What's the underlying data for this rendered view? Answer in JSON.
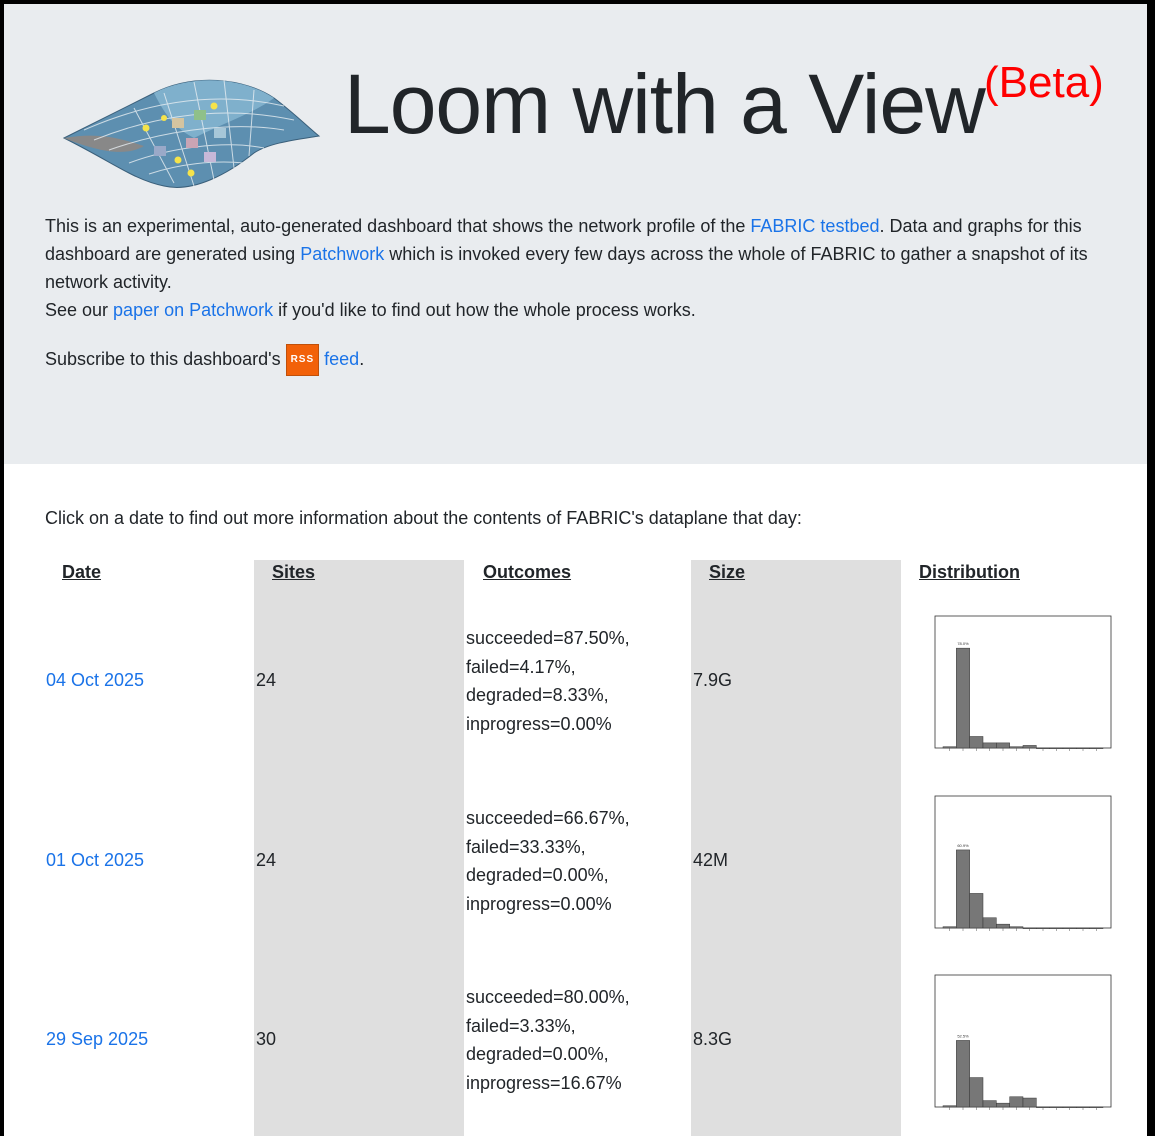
{
  "header": {
    "title": "Loom with a View",
    "badge": "(Beta)"
  },
  "intro": {
    "t1": "This is an experimental, auto-generated dashboard that shows the network profile of the ",
    "link1": "FABRIC testbed",
    "t2": ". Data and graphs for this dashboard are generated using ",
    "link2": "Patchwork",
    "t3": " which is invoked every few days across the whole of FABRIC to gather a snapshot of its network activity.",
    "t4": "See our ",
    "link3": "paper on Patchwork",
    "t5": " if you'd like to find out how the whole process works."
  },
  "subscribe": {
    "text": "Subscribe to this dashboard's ",
    "rss_badge": "RSS",
    "feed_link": "feed",
    "end": "."
  },
  "prompt": "Click on a date to find out more information about the contents of FABRIC's dataplane that day:",
  "table": {
    "headers": [
      "Date",
      "Sites",
      "Outcomes",
      "Size",
      "Distribution"
    ],
    "rows": [
      {
        "date": "04 Oct 2025",
        "sites": "24",
        "outcomes": [
          "succeeded=87.50%,",
          "failed=4.17%,",
          "degraded=8.33%,",
          "inprogress=0.00%"
        ],
        "size": "7.9G",
        "chart": {
          "peak_label": "78.0%",
          "bars": [
            1,
            78,
            9,
            4,
            4,
            1,
            2,
            0,
            0,
            0,
            0,
            0
          ]
        }
      },
      {
        "date": "01 Oct 2025",
        "sites": "24",
        "outcomes": [
          "succeeded=66.67%,",
          "failed=33.33%,",
          "degraded=0.00%,",
          "inprogress=0.00%"
        ],
        "size": "42M",
        "chart": {
          "peak_label": "60.9%",
          "bars": [
            1,
            61,
            27,
            8,
            3,
            1,
            0,
            0,
            0,
            0,
            0,
            0
          ]
        }
      },
      {
        "date": "29 Sep 2025",
        "sites": "30",
        "outcomes": [
          "succeeded=80.00%,",
          "failed=3.33%,",
          "degraded=0.00%,",
          "inprogress=16.67%"
        ],
        "size": "8.3G",
        "chart": {
          "peak_label": "52.5%",
          "bars": [
            1,
            52,
            23,
            5,
            3,
            8,
            7,
            0,
            0,
            0,
            0,
            0
          ]
        }
      }
    ]
  }
}
